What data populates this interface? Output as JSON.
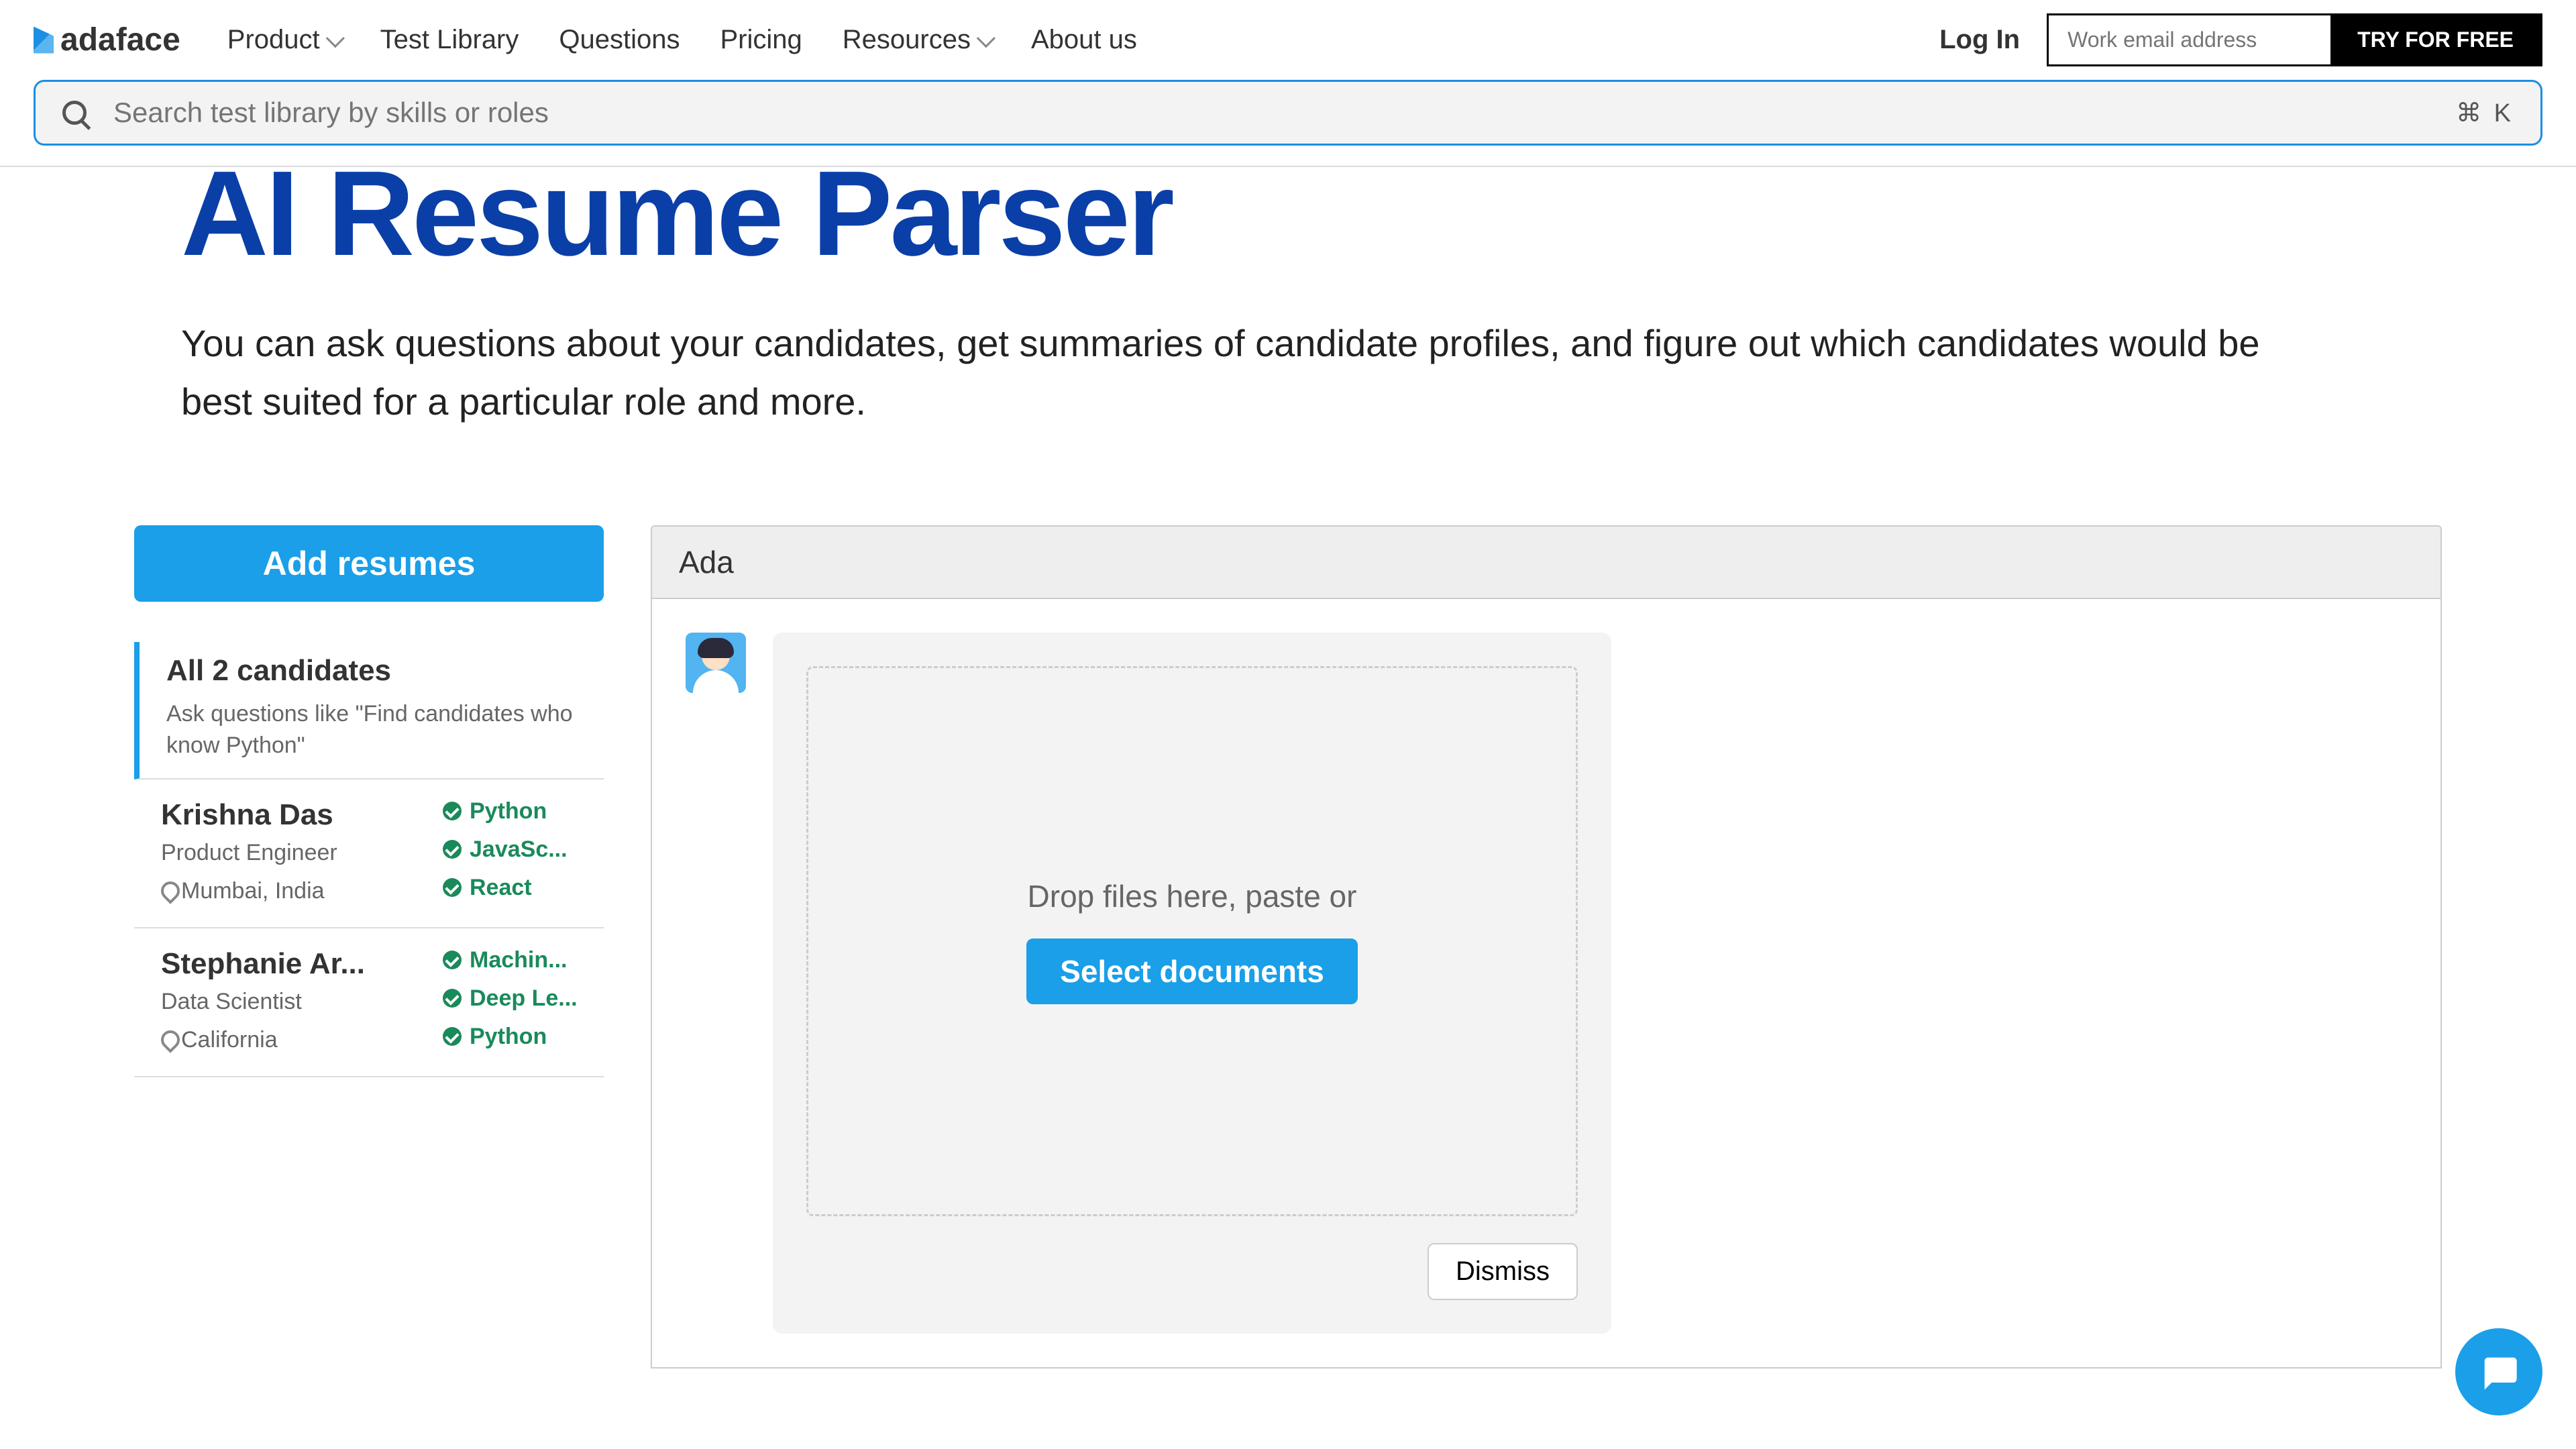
{
  "brand": "adaface",
  "nav": {
    "items": [
      "Product",
      "Test Library",
      "Questions",
      "Pricing",
      "Resources",
      "About us"
    ],
    "login": "Log In",
    "email_placeholder": "Work email address",
    "try_label": "TRY FOR FREE"
  },
  "search": {
    "placeholder": "Search test library by skills or roles",
    "shortcut": "⌘ K"
  },
  "hero": {
    "title": "AI Resume Parser",
    "description": "You can ask questions about your candidates, get summaries of candidate profiles, and figure out which candidates would be best suited for a particular role and more."
  },
  "sidebar": {
    "add_label": "Add resumes",
    "all_title": "All 2 candidates",
    "all_sub": "Ask questions like \"Find candidates who know Python\"",
    "candidates": [
      {
        "name": "Krishna Das",
        "role": "Product Engineer",
        "location": "Mumbai, India",
        "skills": [
          "Python",
          "JavaSc...",
          "React"
        ]
      },
      {
        "name": "Stephanie Ar...",
        "role": "Data Scientist",
        "location": "California",
        "skills": [
          "Machin...",
          "Deep Le...",
          "Python"
        ]
      }
    ]
  },
  "chat": {
    "title": "Ada",
    "drop_text": "Drop files here, paste or",
    "select_label": "Select documents",
    "dismiss_label": "Dismiss"
  }
}
